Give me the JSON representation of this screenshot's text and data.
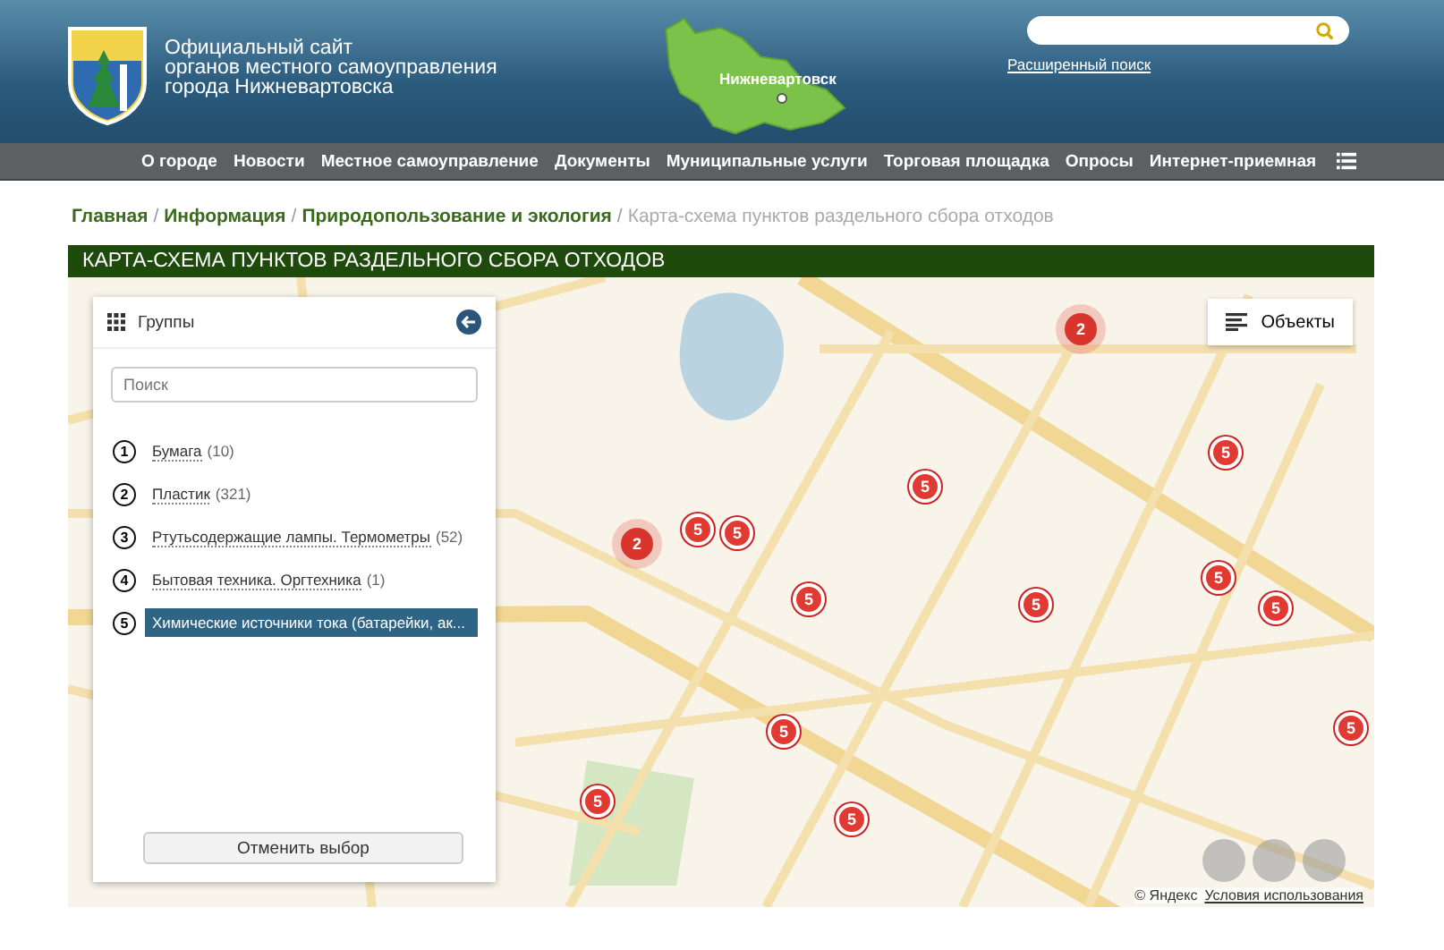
{
  "header": {
    "site_title": "Официальный сайт\nорганов местного самоуправления\nгорода Нижневартовска",
    "region_label": "Нижневартовск",
    "advanced_search": "Расширенный поиск"
  },
  "nav": [
    "О городе",
    "Новости",
    "Местное самоуправление",
    "Документы",
    "Муниципальные услуги",
    "Торговая площадка",
    "Опросы",
    "Интернет-приемная"
  ],
  "breadcrumb_separator": "/",
  "breadcrumbs": [
    {
      "label": "Главная",
      "current": false
    },
    {
      "label": "Информация",
      "current": false
    },
    {
      "label": "Природопользование и экология",
      "current": false
    },
    {
      "label": "Карта-схема пунктов раздельного сбора отходов",
      "current": true
    }
  ],
  "section_title": "КАРТА-СХЕМА ПУНКТОВ РАЗДЕЛЬНОГО СБОРА ОТХОДОВ",
  "map": {
    "objects_button": "Объекты",
    "copyright": "© Яндекс",
    "terms_link": "Условия использования",
    "markers": [
      {
        "kind": "cluster",
        "label": "2"
      },
      {
        "kind": "cluster",
        "label": "2"
      },
      {
        "kind": "point",
        "label": "5"
      },
      {
        "kind": "point",
        "label": "5"
      },
      {
        "kind": "point",
        "label": "5"
      },
      {
        "kind": "point",
        "label": "5"
      },
      {
        "kind": "point",
        "label": "5"
      },
      {
        "kind": "point",
        "label": "5"
      },
      {
        "kind": "point",
        "label": "5"
      },
      {
        "kind": "point",
        "label": "5"
      },
      {
        "kind": "point",
        "label": "5"
      },
      {
        "kind": "point",
        "label": "5"
      },
      {
        "kind": "point",
        "label": "5"
      },
      {
        "kind": "point",
        "label": "5"
      }
    ]
  },
  "groups_panel": {
    "title": "Группы",
    "search": {
      "placeholder": "Поиск"
    },
    "reset_button": "Отменить выбор",
    "items": [
      {
        "number": "1",
        "label": "Бумага",
        "count": "(10)",
        "selected": false
      },
      {
        "number": "2",
        "label": "Пластик",
        "count": "(321)",
        "selected": false
      },
      {
        "number": "3",
        "label": "Ртутьсодержащие лампы. Термометры",
        "count": "(52)",
        "selected": false
      },
      {
        "number": "4",
        "label": "Бытовая техника. Оргтехника",
        "count": "(1)",
        "selected": false
      },
      {
        "number": "5",
        "label": "Химические источники тока (батарейки, ак...",
        "selected": true
      }
    ]
  }
}
